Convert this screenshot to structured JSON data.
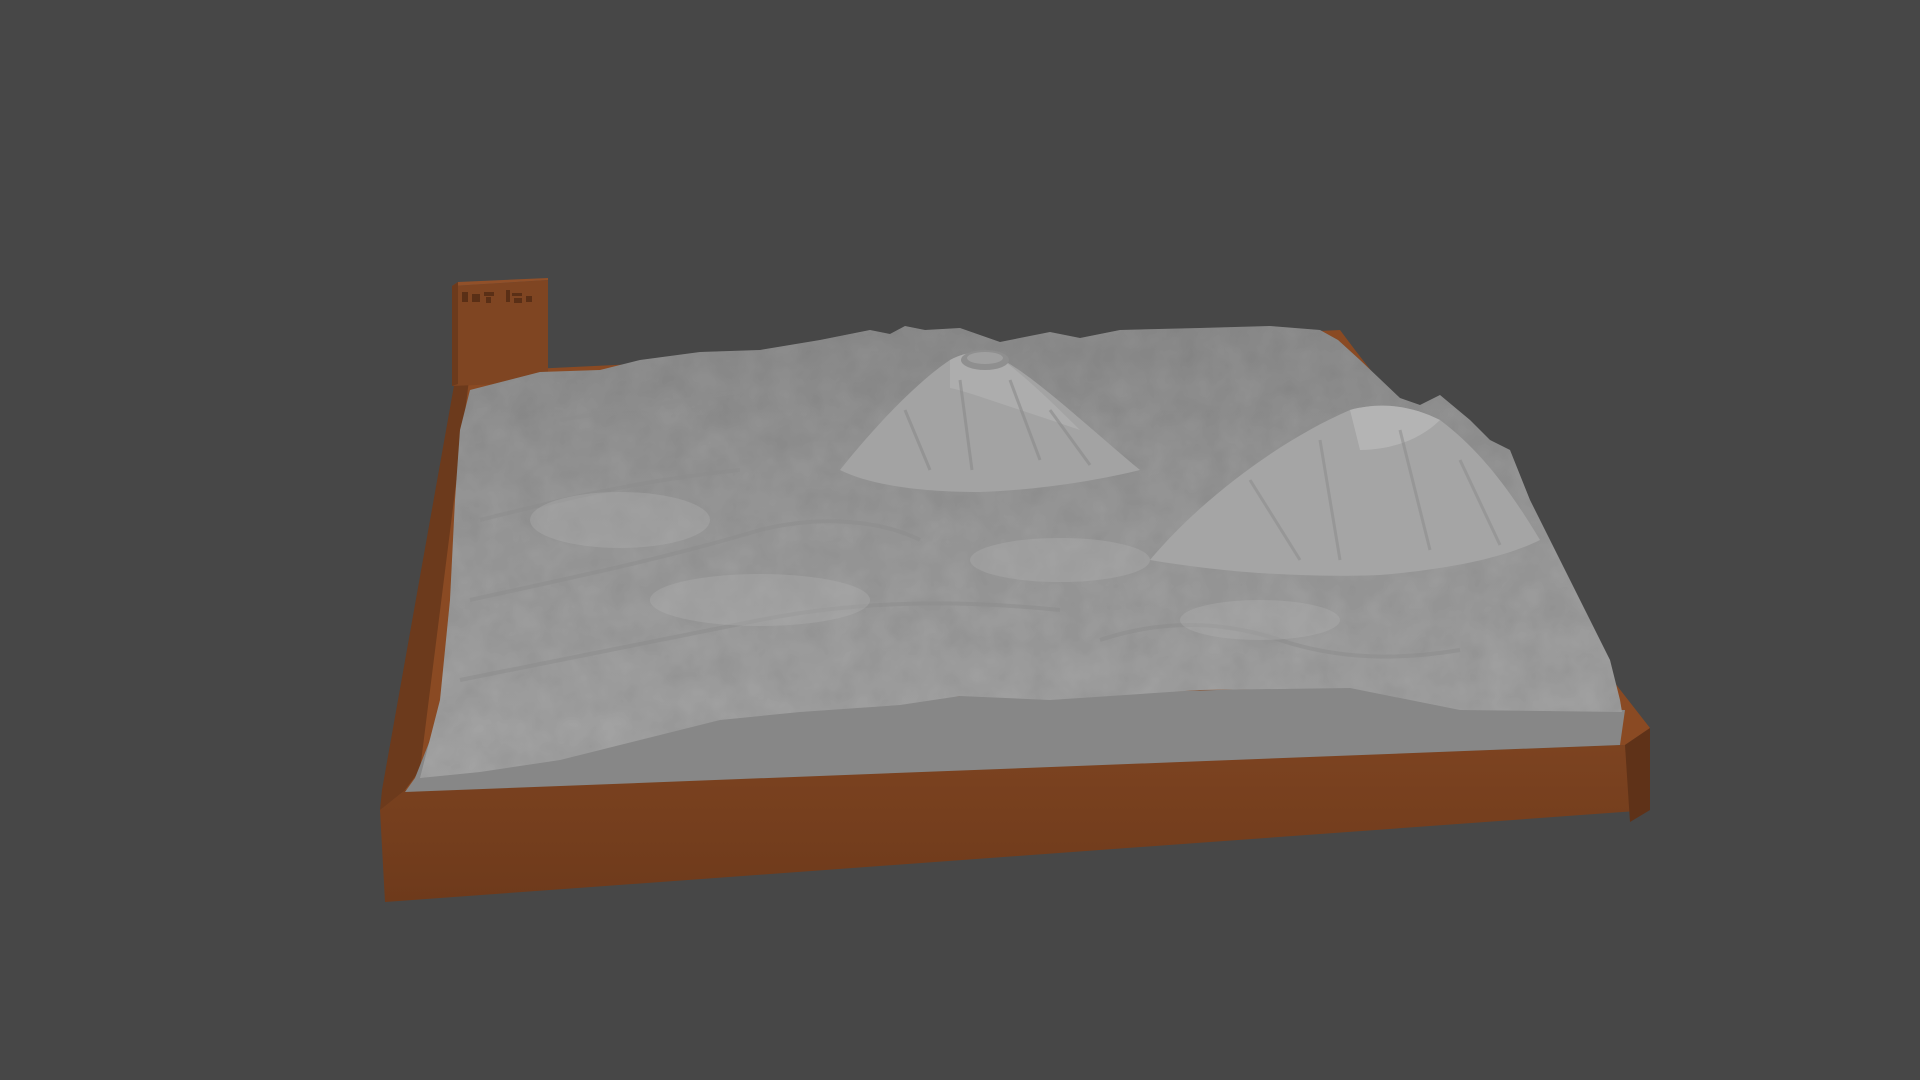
{
  "scene": {
    "background_color": "#474747",
    "base_color": "#7a4220",
    "base_top_color": "#8a4c24",
    "terrain_color": "#9a9a9a",
    "terrain_side_color": "#878787",
    "label_tab_color": "#7f4522"
  }
}
